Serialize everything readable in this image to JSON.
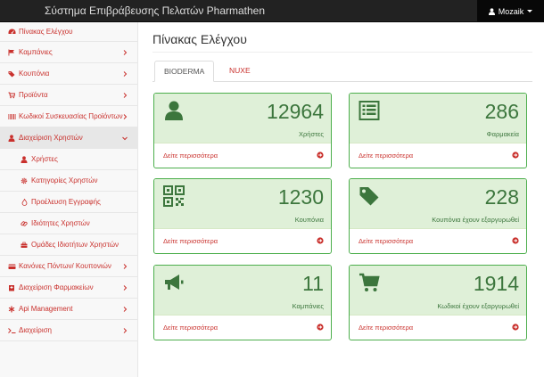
{
  "navbar": {
    "brand": "Σύστημα Επιβράβευσης Πελατών Pharmathen",
    "user": "Mozaik",
    "colors": {
      "background": "#222222",
      "user_bg": "#080808"
    }
  },
  "sidebar": {
    "items": [
      {
        "label": "Πίνακας Ελέγχου",
        "icon": "dashboard-icon"
      },
      {
        "label": "Καμπάνιες",
        "icon": "flag-icon"
      },
      {
        "label": "Κουπόνια",
        "icon": "tags-icon"
      },
      {
        "label": "Προϊόντα",
        "icon": "shopping-cart-icon"
      },
      {
        "label": "Κωδικοί Συσκευασίας Προϊόντων",
        "icon": "barcode-icon"
      },
      {
        "label": "Διαχείριση Χρηστών",
        "icon": "user-icon"
      },
      {
        "label": "Χρήστες",
        "icon": "user-icon"
      },
      {
        "label": "Κατηγορίες Χρηστών",
        "icon": "gear-icon"
      },
      {
        "label": "Προέλευση Εγγραφής",
        "icon": "fire-icon"
      },
      {
        "label": "Ιδιότητες Χρηστών",
        "icon": "link-icon"
      },
      {
        "label": "Ομάδες Ιδιοτήτων Χρηστών",
        "icon": "briefcase-icon"
      },
      {
        "label": "Κανόνες Πόντων/ Κουπονιών",
        "icon": "credit-card-icon"
      },
      {
        "label": "Διαχείριση Φαρμακείων",
        "icon": "hospital-icon"
      },
      {
        "label": "Api Management",
        "icon": "asterisk-icon"
      },
      {
        "label": "Διαχείριση",
        "icon": "terminal-icon"
      }
    ],
    "accent": "#c9302c"
  },
  "main": {
    "title": "Πίνακας Ελέγχου",
    "tabs": [
      {
        "label": "BIODERMA",
        "active": true
      },
      {
        "label": "NUXE",
        "active": false
      }
    ],
    "panels": [
      {
        "value": "12964",
        "label": "Χρήστες",
        "icon": "user-icon",
        "link": "Δείτε περισσότερα"
      },
      {
        "value": "286",
        "label": "Φαρμακεία",
        "icon": "list-icon",
        "link": "Δείτε περισσότερα"
      },
      {
        "value": "1230",
        "label": "Κουπόνια",
        "icon": "qrcode-icon",
        "link": "Δείτε περισσότερα"
      },
      {
        "value": "228",
        "label": "Κουπόνια έχουν εξαργυρωθεί",
        "icon": "tag-icon",
        "link": "Δείτε περισσότερα"
      },
      {
        "value": "11",
        "label": "Καμπάνιες",
        "icon": "bullhorn-icon",
        "link": "Δείτε περισσότερα"
      },
      {
        "value": "1914",
        "label": "Κωδικοί έχουν εξαργυρωθεί",
        "icon": "shopping-cart-icon",
        "link": "Δείτε περισσότερα"
      }
    ],
    "colors": {
      "panel_border": "#4cae4c",
      "panel_head": "#dff0d8",
      "number": "#3c763d",
      "link": "#c9302c"
    }
  }
}
